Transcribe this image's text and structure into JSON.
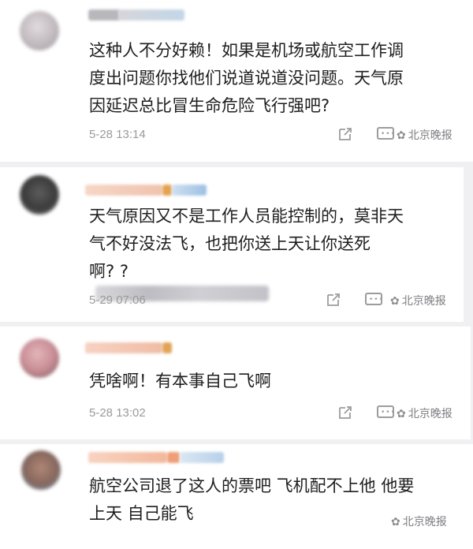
{
  "comments": [
    {
      "lines": [
        "这种人不分好赖！如果是机场或航空工作调",
        "度出问题你找他们说道说道没问题。天气原",
        "因延迟总比冒生命危险飞行强吧?"
      ],
      "time": "5-28 13:14",
      "avatar_colors": [
        "#cfc7cc",
        "#a9a2a6"
      ],
      "name_bar_colors": [
        "#c9c9cd",
        "#b6cfe3"
      ]
    },
    {
      "lines": [
        "天气原因又不是工作人员能控制的，莫非天",
        "气不好没法飞，也把你送上天让你送死",
        "啊?  ?"
      ],
      "time": "5-29 07:06",
      "avatar_colors": [
        "#3a3a3a",
        "#6b6b6b"
      ],
      "name_bar_colors": [
        "#f2c9b8",
        "#e3a455",
        "#9fc2e3"
      ]
    },
    {
      "lines": [
        "凭啥啊！有本事自己飞啊"
      ],
      "time": "5-28 13:02",
      "avatar_colors": [
        "#d7a4ab",
        "#8a6a6f"
      ],
      "name_bar_colors": [
        "#f3c5b3",
        "#e0a358"
      ]
    },
    {
      "lines": [
        "航空公司退了这人的票吧 飞机配不上他 他要",
        "上天 自己能飞"
      ],
      "time": "",
      "avatar_colors": [
        "#a07a6a",
        "#6f8fb3"
      ],
      "name_bar_colors": [
        "#f4c4ad",
        "#f0a27c",
        "#bcd3ea"
      ]
    }
  ],
  "watermark": "北京晚报",
  "icons": {
    "share": "share-icon",
    "comment": "comment-icon",
    "watermark": "wechat-icon"
  }
}
